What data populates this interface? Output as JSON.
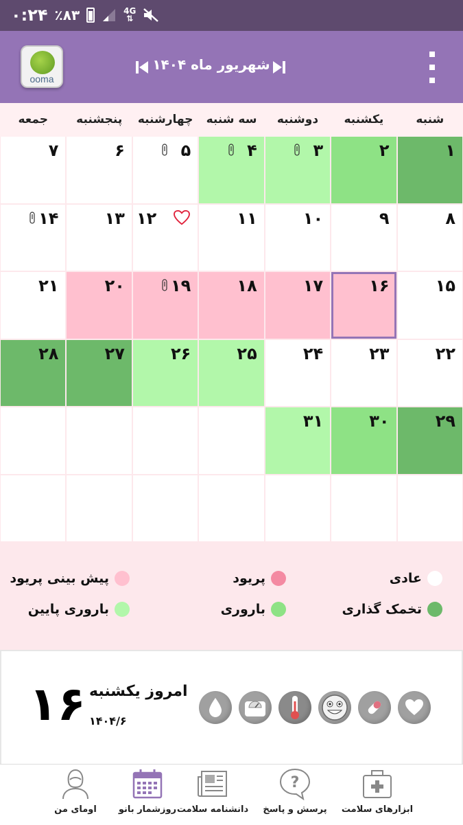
{
  "status_bar": {
    "time": "۰:۲۴",
    "battery": "٪۸۳",
    "network": "4G"
  },
  "header": {
    "logo_text": "ooma",
    "month_title": "شهریور ماه ۱۴۰۴"
  },
  "weekdays": [
    "شنبه",
    "یکشنبه",
    "دوشنبه",
    "سه شنبه",
    "چهارشنبه",
    "پنجشنبه",
    "جمعه"
  ],
  "calendar": {
    "rows": [
      [
        {
          "day": "۱",
          "type": "ovulation"
        },
        {
          "day": "۲",
          "type": "fertile"
        },
        {
          "day": "۳",
          "type": "low-fertile",
          "note": true
        },
        {
          "day": "۴",
          "type": "low-fertile",
          "note": true
        },
        {
          "day": "۵",
          "type": "normal",
          "note": true
        },
        {
          "day": "۶",
          "type": "normal"
        },
        {
          "day": "۷",
          "type": "normal"
        }
      ],
      [
        {
          "day": "۸",
          "type": "normal"
        },
        {
          "day": "۹",
          "type": "normal"
        },
        {
          "day": "۱۰",
          "type": "normal"
        },
        {
          "day": "۱۱",
          "type": "normal"
        },
        {
          "day": "۱۲",
          "type": "normal",
          "heart": true
        },
        {
          "day": "۱۳",
          "type": "normal"
        },
        {
          "day": "۱۴",
          "type": "normal",
          "note": true
        }
      ],
      [
        {
          "day": "۱۵",
          "type": "normal"
        },
        {
          "day": "۱۶",
          "type": "period-pred",
          "today": true
        },
        {
          "day": "۱۷",
          "type": "period-pred"
        },
        {
          "day": "۱۸",
          "type": "period-pred"
        },
        {
          "day": "۱۹",
          "type": "period-pred",
          "note": true
        },
        {
          "day": "۲۰",
          "type": "period-pred"
        },
        {
          "day": "۲۱",
          "type": "normal"
        }
      ],
      [
        {
          "day": "۲۲",
          "type": "normal"
        },
        {
          "day": "۲۳",
          "type": "normal"
        },
        {
          "day": "۲۴",
          "type": "normal"
        },
        {
          "day": "۲۵",
          "type": "low-fertile"
        },
        {
          "day": "۲۶",
          "type": "low-fertile"
        },
        {
          "day": "۲۷",
          "type": "ovulation"
        },
        {
          "day": "۲۸",
          "type": "ovulation"
        }
      ],
      [
        {
          "day": "۲۹",
          "type": "ovulation"
        },
        {
          "day": "۳۰",
          "type": "fertile"
        },
        {
          "day": "۳۱",
          "type": "low-fertile"
        },
        {
          "day": "",
          "type": "empty"
        },
        {
          "day": "",
          "type": "empty"
        },
        {
          "day": "",
          "type": "empty"
        },
        {
          "day": "",
          "type": "empty"
        }
      ],
      [
        {
          "day": "",
          "type": "empty"
        },
        {
          "day": "",
          "type": "empty"
        },
        {
          "day": "",
          "type": "empty"
        },
        {
          "day": "",
          "type": "empty"
        },
        {
          "day": "",
          "type": "empty"
        },
        {
          "day": "",
          "type": "empty"
        },
        {
          "day": "",
          "type": "empty"
        }
      ]
    ]
  },
  "legend": {
    "normal": {
      "label": "عادی",
      "color": "#ffffff"
    },
    "period": {
      "label": "پریود",
      "color": "#f48aa2"
    },
    "period_prediction": {
      "label": "پیش بینی پریود",
      "color": "#ffc0cf"
    },
    "ovulation": {
      "label": "تخمک گذاری",
      "color": "#6db96a"
    },
    "fertile": {
      "label": "باروری",
      "color": "#8ee285"
    },
    "low_fertile": {
      "label": "باروری پایین",
      "color": "#b2f7aa"
    }
  },
  "today": {
    "day_number": "۱۶",
    "label": "امروز یکشنبه",
    "date": "۱۴۰۴/۶",
    "tools": [
      "heart-icon",
      "pill-icon",
      "smiley-icon",
      "thermometer-icon",
      "scale-icon",
      "drop-icon"
    ]
  },
  "bottom_nav": {
    "items": [
      {
        "label": "ابزارهای سلامت",
        "icon": "first-aid-kit-icon"
      },
      {
        "label": "پرسش و پاسخ",
        "icon": "question-icon"
      },
      {
        "label": "دانشنامه سلامت",
        "icon": "newspaper-icon"
      },
      {
        "label": "روزشمار بانو",
        "icon": "calendar-icon",
        "active": true
      },
      {
        "label": "اومای من",
        "icon": "profile-icon"
      }
    ]
  },
  "colors": {
    "status_bar": "#5e4a6e",
    "header": "#9474b6",
    "today_outline": "#9474b6",
    "legend_bg": "#fde8ec"
  }
}
